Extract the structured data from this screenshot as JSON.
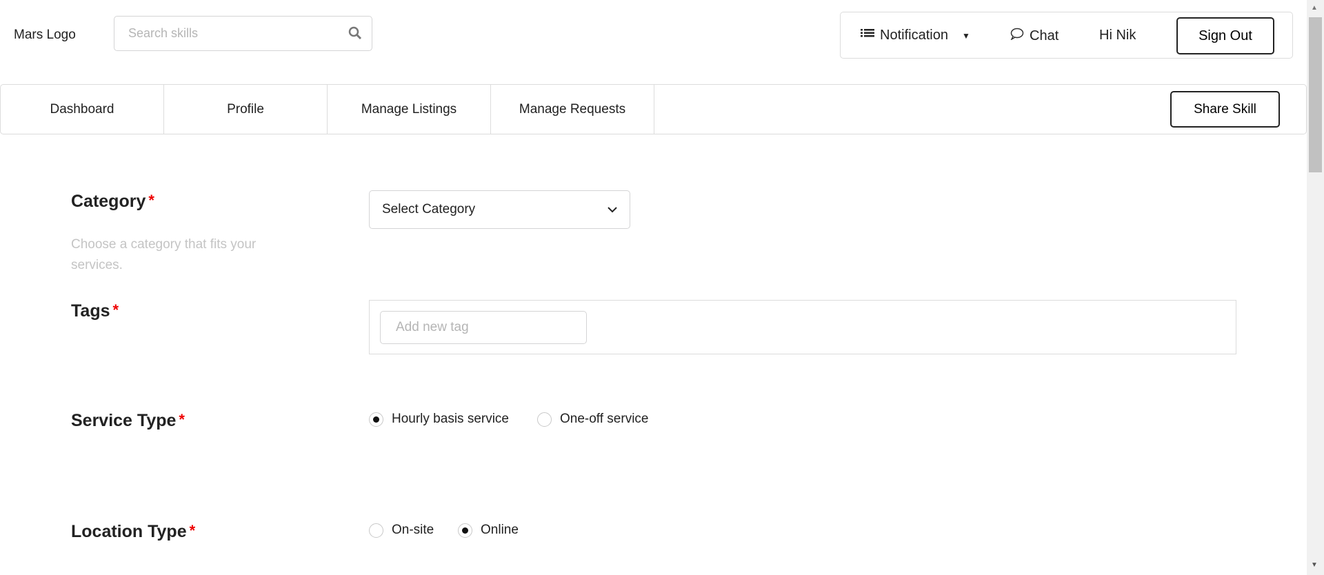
{
  "header": {
    "logo": "Mars Logo",
    "search_placeholder": "Search skills",
    "notification": "Notification",
    "chat": "Chat",
    "greeting": "Hi Nik",
    "sign_out": "Sign Out"
  },
  "nav": {
    "items": [
      "Dashboard",
      "Profile",
      "Manage Listings",
      "Manage Requests"
    ],
    "share_skill": "Share Skill"
  },
  "form": {
    "category": {
      "label": "Category",
      "required": "*",
      "help": "Choose a category that fits your services.",
      "select_value": "Select Category"
    },
    "tags": {
      "label": "Tags",
      "required": "*",
      "placeholder": "Add new tag"
    },
    "service_type": {
      "label": "Service Type",
      "required": "*",
      "options": [
        "Hourly basis service",
        "One-off service"
      ],
      "selected": "Hourly basis service"
    },
    "location_type": {
      "label": "Location Type",
      "required": "*",
      "options": [
        "On-site",
        "Online"
      ],
      "selected": "Online"
    }
  }
}
